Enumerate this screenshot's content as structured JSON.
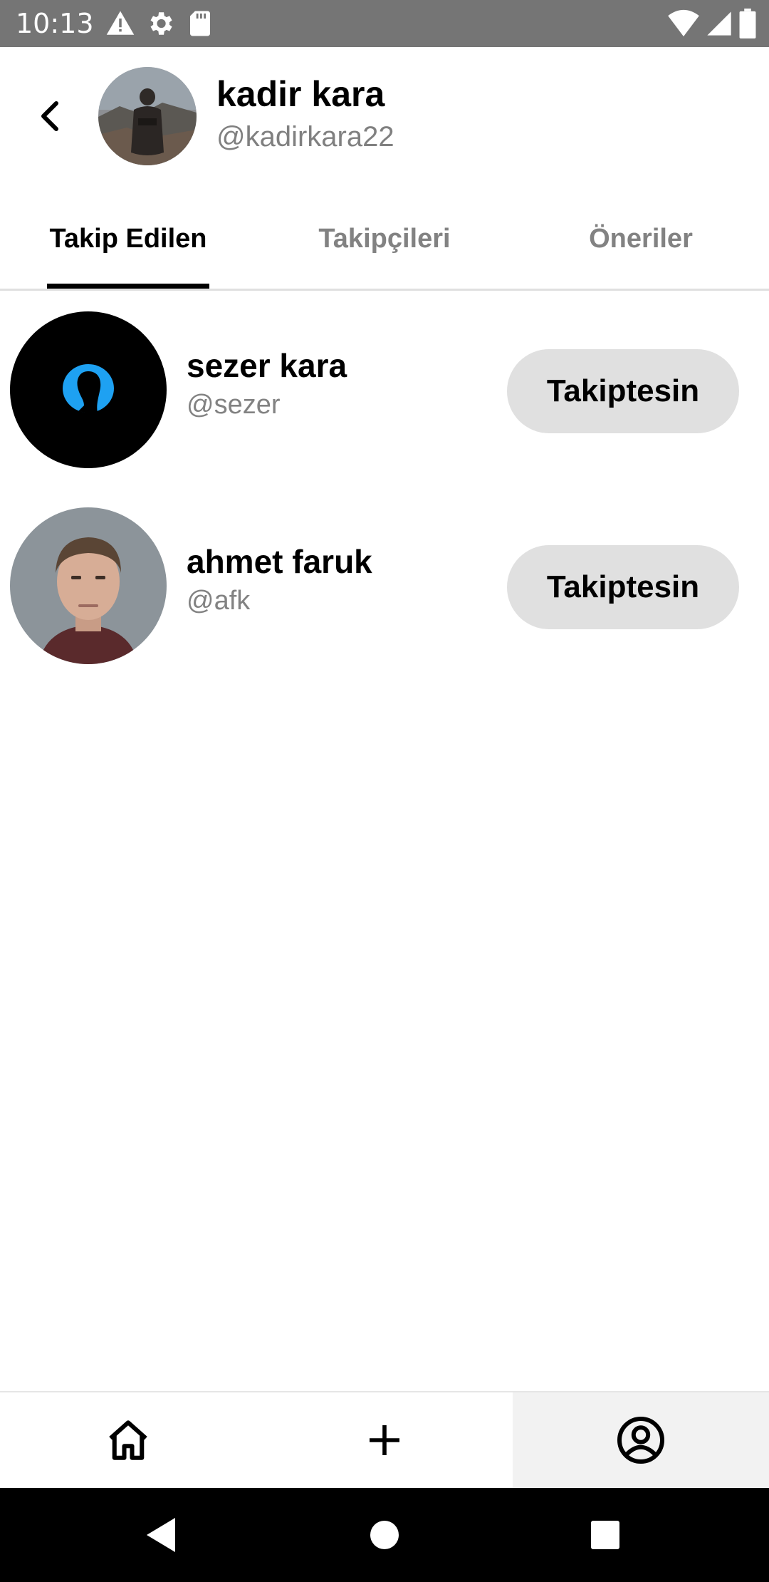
{
  "status_bar": {
    "time": "10:13",
    "left_icons": [
      "warning-icon",
      "gear-icon",
      "sd-card-icon"
    ],
    "right_icons": [
      "wifi-icon",
      "cellular-icon",
      "battery-icon"
    ]
  },
  "header": {
    "name": "kadir kara",
    "handle": "@kadirkara22"
  },
  "tabs": [
    {
      "label": "Takip Edilen",
      "active": true
    },
    {
      "label": "Takipçileri",
      "active": false
    },
    {
      "label": "Öneriler",
      "active": false
    }
  ],
  "users": [
    {
      "name": "sezer kara",
      "handle": "@sezer",
      "button_label": "Takiptesin"
    },
    {
      "name": "ahmet faruk",
      "handle": "@afk",
      "button_label": "Takiptesin"
    }
  ],
  "bottom_nav": {
    "items": [
      "home-icon",
      "add-icon",
      "profile-icon"
    ],
    "selected": "profile-icon"
  },
  "system_nav": [
    "back-triangle-icon",
    "home-circle-icon",
    "recents-square-icon"
  ],
  "colors": {
    "status_bar": "#757575",
    "button_bg": "#e0e0e0",
    "secondary_text": "#828282",
    "accent_blue": "#1ea1f2",
    "nav_selected_bg": "#f2f2f2"
  }
}
